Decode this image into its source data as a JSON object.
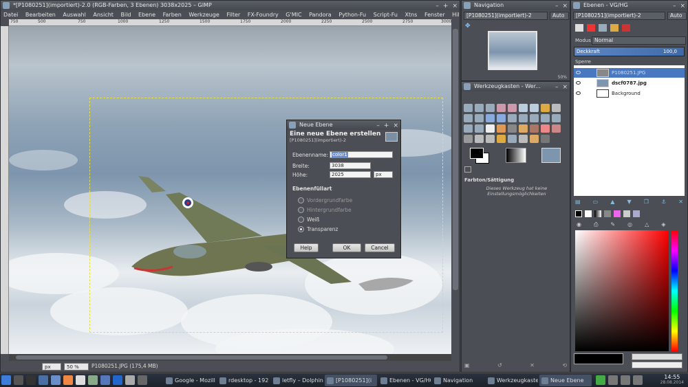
{
  "gimp": {
    "title": "*[P1080251](importiert)-2.0 (RGB-Farben, 3 Ebenen) 3038x2025 – GIMP",
    "menu": [
      "Datei",
      "Bearbeiten",
      "Auswahl",
      "Ansicht",
      "Bild",
      "Ebene",
      "Farben",
      "Werkzeuge",
      "Filter",
      "FX-Foundry",
      "G'MIC",
      "Pandora",
      "Python-Fu",
      "Script-Fu",
      "Xtns",
      "Fenster",
      "Hilfe"
    ],
    "ruler_ticks": [
      "750",
      "500",
      "750",
      "1000",
      "1250",
      "1500",
      "1750",
      "2000",
      "2250",
      "2500",
      "2750",
      "3000"
    ],
    "unit": "px",
    "zoom": "50 %",
    "status": "P1080251.JPG (175,4 MB)"
  },
  "dialog": {
    "title": "Neue Ebene",
    "heading": "Eine neue Ebene erstellen",
    "subheading": "[P1080251](importiert)-2",
    "name_label": "Ebenenname:",
    "name_value": "color1",
    "width_label": "Breite:",
    "width_value": "3038",
    "height_label": "Höhe:",
    "height_value": "2025",
    "unit": "px",
    "fill_label": "Ebenenfüllart",
    "fill_options": [
      "Vordergrundfarbe",
      "Hintergrundfarbe",
      "Weiß",
      "Transparenz"
    ],
    "fill_selected": "Transparenz",
    "help": "Help",
    "ok": "OK",
    "cancel": "Cancel"
  },
  "navigation": {
    "title": "Navigation",
    "combo": "[P1080251](importiert)-2",
    "auto": "Auto",
    "zoom": "50%"
  },
  "toolbox": {
    "title": "Werkzeugkasten - Wer...",
    "options_title": "Farbton/Sättigung",
    "options_text": "Dieses Werkzeug hat keine Einstellungsmöglichkeiten"
  },
  "layers": {
    "title": "Ebenen - VG/HG",
    "combo": "[P1080251](importiert)-2",
    "auto": "Auto",
    "mode_label": "Modus",
    "mode_value": "Normal",
    "opacity_label": "Deckkraft",
    "opacity_value": "100,0",
    "lock_label": "Sperre",
    "items": [
      {
        "name": "P1080251.JPG",
        "active": true
      },
      {
        "name": "dscf0787.jpg",
        "active": false
      },
      {
        "name": "Background",
        "active": false
      }
    ]
  },
  "taskbar": {
    "items": [
      "Google - Mozill",
      "rdesktop - 192",
      "letfly – Dolphin",
      "[P1080251](i",
      "Ebenen - VG/HG",
      "Navigation",
      "Werkzeugkaste",
      "Neue Ebene"
    ],
    "time": "14:55",
    "date": "28.08.2014"
  }
}
